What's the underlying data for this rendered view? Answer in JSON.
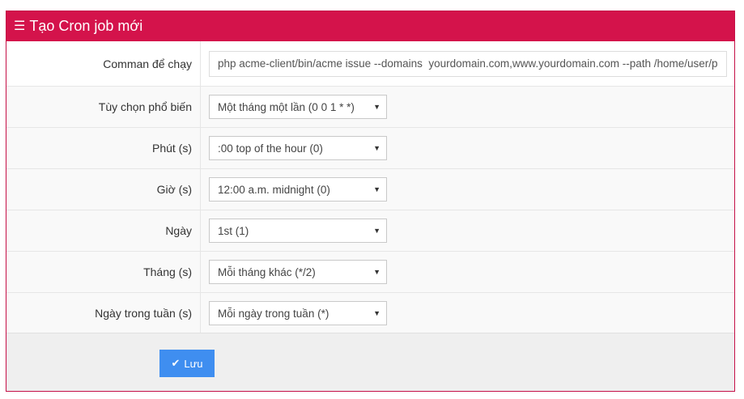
{
  "header": {
    "title": "Tạo Cron job mới",
    "icon": "menu-icon"
  },
  "colors": {
    "header_bg": "#d4134b",
    "button_bg": "#3f8ef0"
  },
  "form": {
    "command": {
      "label": "Comman để chạy",
      "value": "php acme-client/bin/acme issue --domains  yourdomain.com,www.yourdomain.com --path /home/user/public_html"
    },
    "common_option": {
      "label": "Tùy chọn phổ biến",
      "selected": "Một tháng một lần (0 0 1 * *)"
    },
    "minute": {
      "label": "Phút (s)",
      "selected": ":00 top of the hour (0)"
    },
    "hour": {
      "label": "Giờ (s)",
      "selected": "12:00 a.m. midnight (0)"
    },
    "day": {
      "label": "Ngày",
      "selected": "1st (1)"
    },
    "month": {
      "label": "Tháng (s)",
      "selected": "Mỗi tháng khác (*/2)"
    },
    "weekday": {
      "label": "Ngày trong tuần (s)",
      "selected": "Mỗi ngày trong tuần (*)"
    }
  },
  "footer": {
    "save_label": "Lưu",
    "save_icon": "check-icon"
  }
}
